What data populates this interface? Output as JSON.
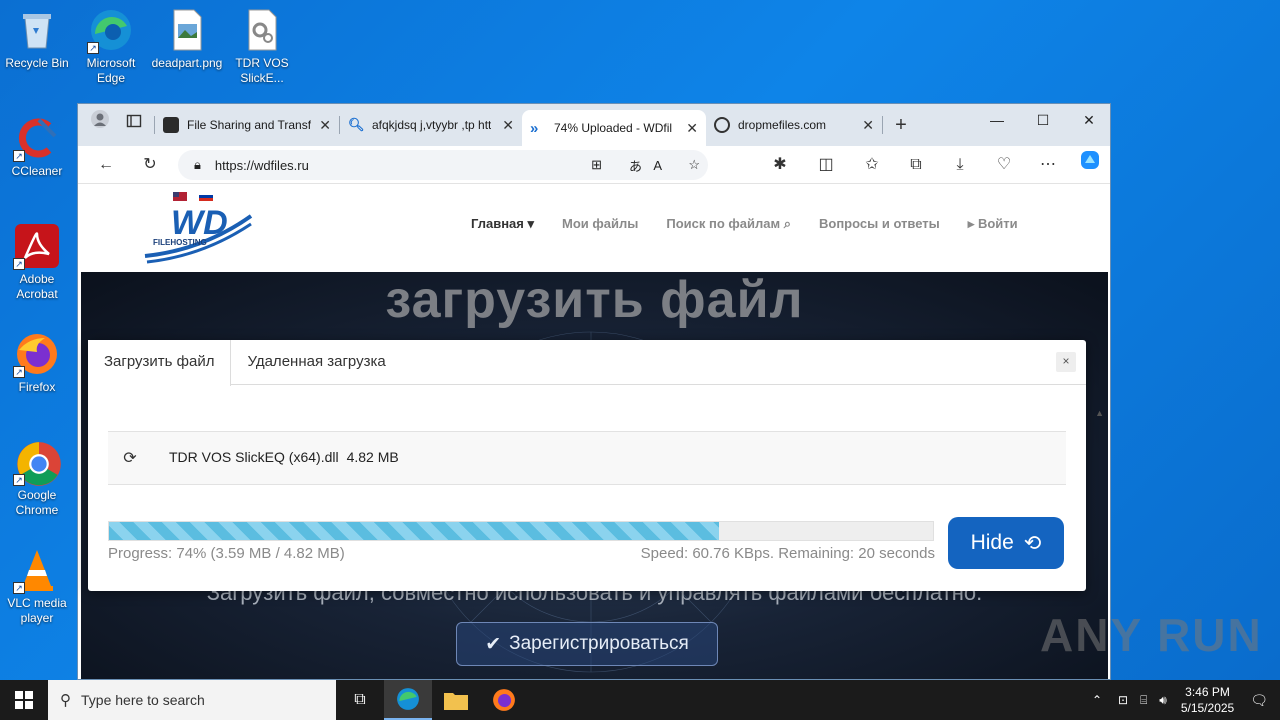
{
  "desktop": {
    "icons": [
      {
        "label": "Recycle Bin"
      },
      {
        "label": "Microsoft Edge"
      },
      {
        "label": "deadpart.png"
      },
      {
        "label": "TDR VOS SlickE..."
      },
      {
        "label": "CCleaner"
      },
      {
        "label": "Adobe Acrobat"
      },
      {
        "label": "Firefox"
      },
      {
        "label": "Google Chrome"
      },
      {
        "label": "VLC media player"
      }
    ]
  },
  "browser": {
    "tabs": [
      {
        "label": "File Sharing and Transf",
        "icon": "file-sharing-favicon"
      },
      {
        "label": "afqkjdsq j,vtyybr ,tp htt",
        "icon": "search-icon"
      },
      {
        "label": "74% Uploaded - WDfil",
        "icon": "wdfiles-favicon",
        "active": true
      },
      {
        "label": "dropmefiles.com",
        "icon": "dropmefiles-favicon"
      }
    ],
    "url": "https://wdfiles.ru"
  },
  "site": {
    "logo_text": "WD",
    "logo_sub": "FILEHOSTING",
    "nav": [
      "Главная",
      "Мои файлы",
      "Поиск по файлам",
      "Вопросы и ответы",
      "Войти"
    ],
    "hero_title": "загрузить файл",
    "hero_subtitle": "Загрузить файл, совместно использовать и управлять файлами бесплатно.",
    "register_label": "Зарегистрироваться"
  },
  "modal": {
    "tabs": [
      "Загрузить файл",
      "Удаленная загрузка"
    ],
    "close": "×",
    "file_name": "TDR VOS SlickEQ (x64).dll",
    "file_size": "4.82 MB",
    "progress_fraction": 0.74,
    "progress_text": "Progress: 74% (3.59 MB / 4.82 MB)",
    "speed_text": "Speed: 60.76 KBps. Remaining: 20 seconds",
    "hide_label": "Hide"
  },
  "watermark": "ANY RUN",
  "taskbar": {
    "search_placeholder": "Type here to search",
    "time": "3:46 PM",
    "date": "5/15/2025"
  }
}
